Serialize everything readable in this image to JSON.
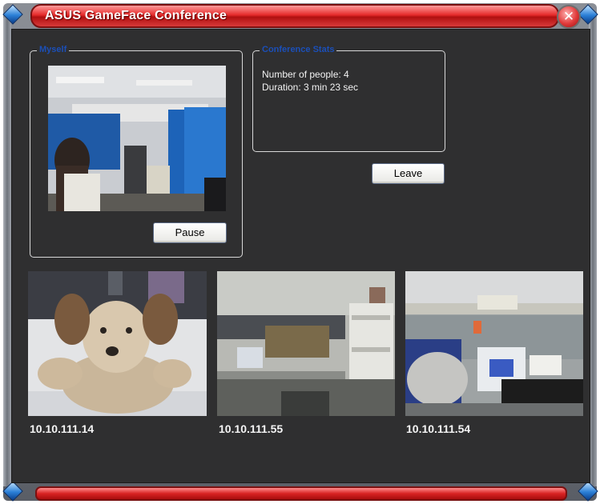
{
  "window": {
    "title": "ASUS GameFace Conference",
    "close_icon": "close-icon"
  },
  "colors": {
    "title_red": "#e52b2b",
    "panel_bg": "#2f2f30",
    "legend_blue": "#1b4fb8"
  },
  "myself": {
    "legend": "Myself",
    "pause_label": "Pause"
  },
  "conference": {
    "legend": "Conference Stats",
    "people_line": "Number of people: 4",
    "duration_line": "Duration: 3 min 23 sec",
    "leave_label": "Leave"
  },
  "participants": [
    {
      "ip": "10.10.111.14"
    },
    {
      "ip": "10.10.111.55"
    },
    {
      "ip": "10.10.111.54"
    }
  ]
}
